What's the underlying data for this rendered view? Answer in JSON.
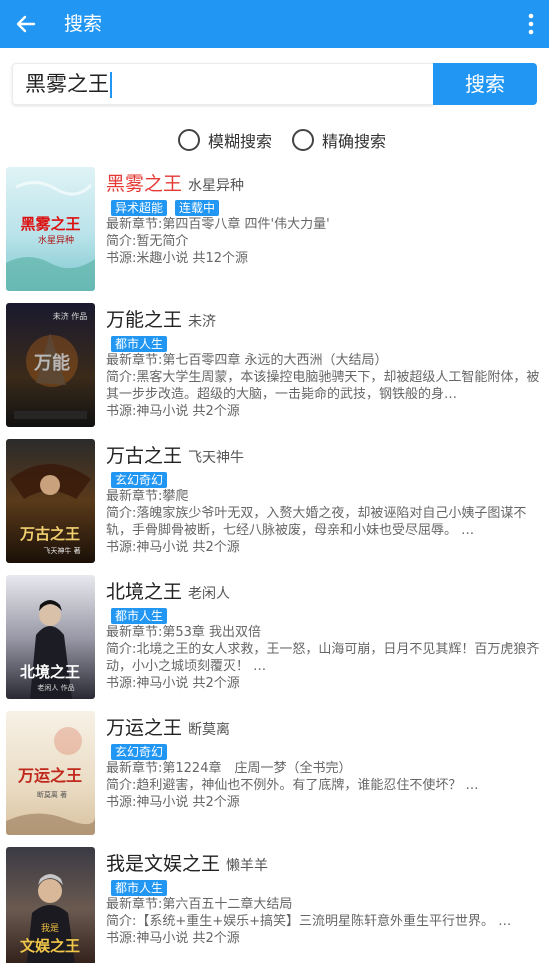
{
  "appbar": {
    "title": "搜索"
  },
  "search": {
    "value": "黑雾之王",
    "button": "搜索"
  },
  "modes": {
    "fuzzy": "模糊搜索",
    "exact": "精确搜索"
  },
  "colors": {
    "primary": "#2196f3",
    "highlight": "#e53935"
  },
  "books": [
    {
      "name": "黑雾之王",
      "author": "水星异种",
      "tags": [
        "异术超能",
        "连载中"
      ],
      "latest": "最新章节:第四百零八章 四件'伟大力量'",
      "intro": "简介:暂无简介",
      "source": "书源:米趣小说 共12个源",
      "cover_text": "黑雾之王",
      "cover_sub": "水星异种"
    },
    {
      "name": "万能之王",
      "author": "未济",
      "tags": [
        "都市人生"
      ],
      "latest": "最新章节:第七百零四章 永远的大西洲（大结局）",
      "intro": "简介:黑客大学生周蒙，本该操控电脑驰骋天下，却被超级人工智能附体，被其一步步改造。超级的大脑，一击毙命的武技，钢铁般的身…",
      "source": "书源:神马小说 共2个源",
      "cover_text": "万能",
      "cover_sub": "未济 作品"
    },
    {
      "name": "万古之王",
      "author": "飞天神牛",
      "tags": [
        "玄幻奇幻"
      ],
      "latest": "最新章节:攀爬",
      "intro": "简介:落魄家族少爷叶无双，入赘大婚之夜，却被诬陷对自己小姨子图谋不轨，手骨脚骨被断，七经八脉被废，母亲和小妹也受尽屈辱。 …",
      "source": "书源:神马小说 共2个源",
      "cover_text": "万古之王",
      "cover_sub": "飞天神牛 著"
    },
    {
      "name": "北境之王",
      "author": "老闲人",
      "tags": [
        "都市人生"
      ],
      "latest": "最新章节:第53章 我出双倍",
      "intro": "简介:北境之王的女人求救，王一怒，山海可崩，日月不见其辉！百万虎狼齐动，小小之城顷刻覆灭！ …",
      "source": "书源:神马小说 共2个源",
      "cover_text": "北境之王",
      "cover_sub": "老闲人 作品"
    },
    {
      "name": "万运之王",
      "author": "断莫离",
      "tags": [
        "玄幻奇幻"
      ],
      "latest": "最新章节:第1224章　庄周一梦（全书完）",
      "intro": "简介:趋利避害，神仙也不例外。有了底牌，谁能忍住不使坏？ …",
      "source": "书源:神马小说 共2个源",
      "cover_text": "万运之王",
      "cover_sub": "断莫离 著"
    },
    {
      "name": "我是文娱之王",
      "author": "懒羊羊",
      "tags": [
        "都市人生"
      ],
      "latest": "最新章节:第六百五十二章大结局",
      "intro": "简介:【系统+重生+娱乐+搞笑】三流明星陈轩意外重生平行世界。 …",
      "source": "书源:神马小说 共2个源",
      "cover_text": "文娱之王",
      "cover_sub": "我是"
    }
  ]
}
